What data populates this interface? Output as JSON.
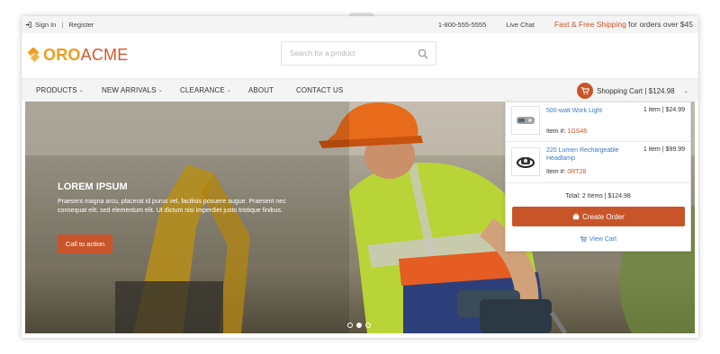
{
  "topbar": {
    "signin": "Sign In",
    "separator": "|",
    "register": "Register",
    "phone": "1-800-555-5555",
    "live_chat": "Live Chat",
    "shipping_highlight": "Fast & Free Shipping",
    "shipping_rest": " for orders over $45"
  },
  "logo": {
    "part1": "ORO",
    "part2": "ACME"
  },
  "search": {
    "placeholder": "Search for a product",
    "icon": "search-icon"
  },
  "nav": {
    "items": [
      {
        "label": "PRODUCTS",
        "has_dropdown": true
      },
      {
        "label": "NEW ARRIVALS",
        "has_dropdown": true
      },
      {
        "label": "CLEARANCE",
        "has_dropdown": true
      },
      {
        "label": "ABOUT",
        "has_dropdown": false
      },
      {
        "label": "CONTACT US",
        "has_dropdown": false
      }
    ],
    "cart_label": "Shopping Cart | $124.98",
    "cart_icon": "shopping-cart-icon",
    "chevron": "⌄"
  },
  "hero": {
    "title": "LOREM IPSUM",
    "text": "Praesent magna arcu, placerat id purus vel, facilisis posuere augue. Praesent nec consequat elit, sed elementum elit. Ut dictum nisi imperdiet justo tristique finibus.",
    "cta": "Call to action",
    "slides_count": 3,
    "active_slide": 2
  },
  "cart_dropdown": {
    "items": [
      {
        "name": "500-watt Work Light",
        "qty_price": "1 item | $24.99",
        "item_label": "Item #:",
        "code": "1GS46"
      },
      {
        "name": "220 Lumen Rechargeable Headlamp",
        "qty_price": "1 item | $99.99",
        "item_label": "Item #:",
        "code": "0RT28"
      }
    ],
    "total": "Total: 2 Items | $124.98",
    "create_order": "Create Order",
    "view_cart": "View Cart"
  },
  "colors": {
    "accent": "#c8552a",
    "logo_orange": "#ef9d1e",
    "link_blue": "#3a7bc8",
    "bar_gray": "#f4f4f4"
  }
}
